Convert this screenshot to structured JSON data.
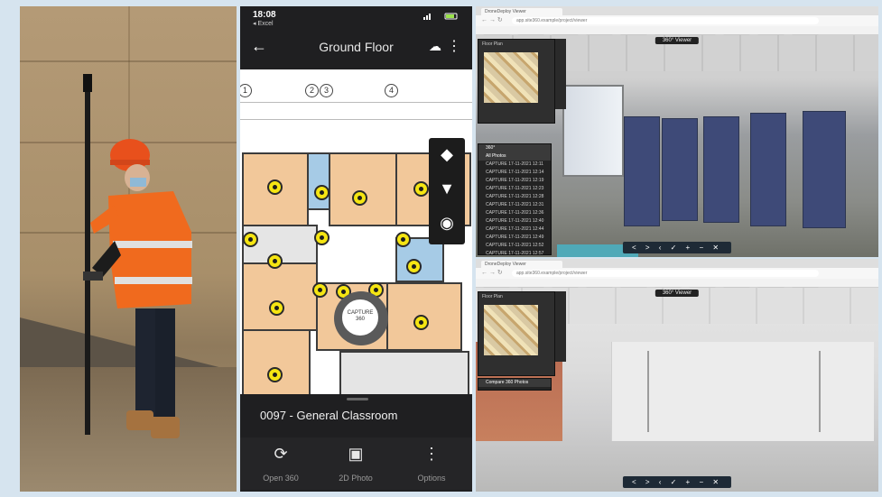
{
  "phone": {
    "status_time": "18:08",
    "status_sub": "◂ Excel",
    "title": "Ground Floor",
    "grid_labels": [
      "1",
      "2",
      "3",
      "4"
    ],
    "camera_label_1": "CAPTURE",
    "camera_label_2": "360",
    "room_name": "0097 - General Classroom",
    "actions": [
      {
        "label": "Open 360",
        "icon": "360-icon"
      },
      {
        "label": "2D Photo",
        "icon": "add-photo-icon"
      },
      {
        "label": "Options",
        "icon": "more-vertical-icon"
      }
    ],
    "colors": {
      "pin": "#f5e512",
      "room": "#f2c89a",
      "room_blue": "#a6cbe6"
    }
  },
  "browser_top": {
    "tab_title": "DroneDeploy Viewer",
    "url": "app.site360.example/project/viewer",
    "view_label": "360° Viewer",
    "map_title": "Floor Plan",
    "dropdown_header": "360°",
    "dropdown_sub": "All Photos",
    "dropdown_items": [
      "CAPTURE 17-11-2021 12:11",
      "CAPTURE 17-11-2021 12:14",
      "CAPTURE 17-11-2021 12:19",
      "CAPTURE 17-11-2021 12:23",
      "CAPTURE 17-11-2021 12:28",
      "CAPTURE 17-11-2021 12:31",
      "CAPTURE 17-11-2021 12:36",
      "CAPTURE 17-11-2021 12:40",
      "CAPTURE 17-11-2021 12:44",
      "CAPTURE 17-11-2021 12:49",
      "CAPTURE 17-11-2021 12:52",
      "CAPTURE 17-11-2021 12:57"
    ],
    "controls": "< > ‹ ✓ + − ✕"
  },
  "browser_bottom": {
    "tab_title": "DroneDeploy Viewer",
    "url": "app.site360.example/project/viewer",
    "view_label": "360° Viewer",
    "map_title": "Floor Plan",
    "layer_label": "Compare 360 Photos",
    "controls": "< > ‹ ✓ + − ✕"
  }
}
